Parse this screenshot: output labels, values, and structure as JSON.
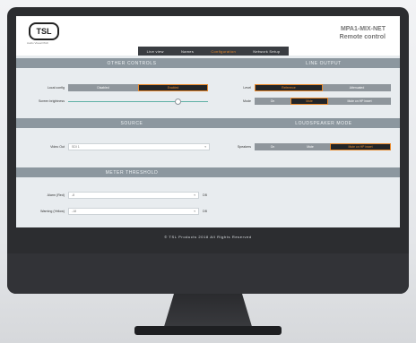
{
  "header": {
    "logo_text": "TSL",
    "logo_sub": "Audio Visual Pitch",
    "device_name": "MPA1-MIX-NET",
    "device_subtitle": "Remote control"
  },
  "tabs": [
    {
      "label": "Live view"
    },
    {
      "label": "Names"
    },
    {
      "label": "Configuration"
    },
    {
      "label": "Network Setup"
    }
  ],
  "sections": {
    "other_controls": "OTHER CONTROLS",
    "line_output": "LINE OUTPUT",
    "source": "SOURCE",
    "loudspeaker_mode": "LOUDSPEAKER MODE",
    "meter_threshold": "METER THRESHOLD"
  },
  "other_controls": {
    "local_config_label": "Local config",
    "disabled_label": "Disabled",
    "enabled_label": "Enabled",
    "screen_brightness_label": "Screen brightness",
    "brightness_level": 0.78
  },
  "line_output": {
    "level_label": "Level",
    "level_reference": "Reference",
    "level_attenuated": "Attenuated",
    "mode_label": "Mode",
    "mode_on": "On",
    "mode_mute": "Mute",
    "mode_mute_on_hp": "Mute on HP insert"
  },
  "source": {
    "video_out_label": "Video Out",
    "video_out_value": "SDI 1"
  },
  "loudspeaker": {
    "speakers_label": "Speakers",
    "on": "On",
    "mute": "Mute",
    "mute_on_hp": "Mute on HP insert"
  },
  "meter_threshold": {
    "alarm_label": "Alarm (Red)",
    "alarm_value": "-8",
    "warning_label": "Warning (Yellow)",
    "warning_value": "-18",
    "unit": "DB"
  },
  "footer": "© TSL Products 2018 All Rights Reserved"
}
